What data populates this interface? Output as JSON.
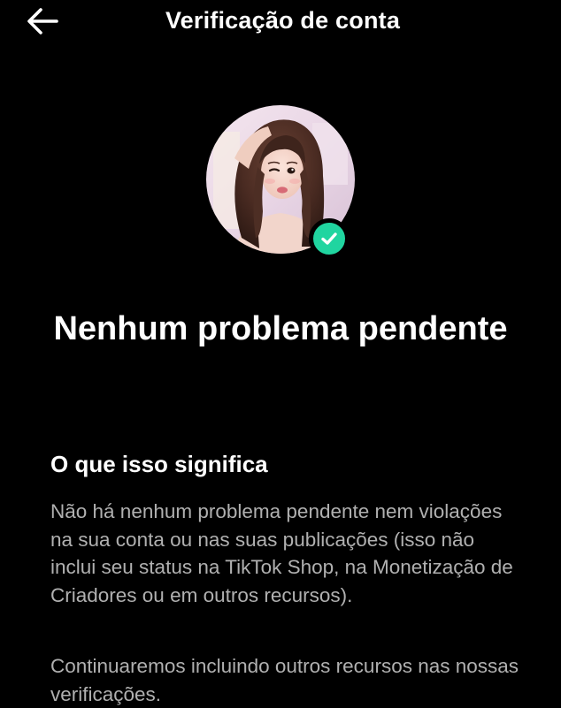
{
  "header": {
    "back_icon": "arrow-left-icon",
    "title": "Verificação de conta"
  },
  "profile": {
    "badge_icon": "check-icon",
    "badge_color": "#20d5a0"
  },
  "status": {
    "title": "Nenhum problema pendente"
  },
  "details": {
    "heading": "O que isso significa",
    "paragraph_1": "Não há nenhum problema pendente nem violações na sua conta ou nas suas publicações (isso não inclui seu status na TikTok Shop, na Monetização de Criadores ou em outros recursos).",
    "paragraph_2": "Continuaremos incluindo outros recursos nas nossas verificações."
  },
  "colors": {
    "background": "#000000",
    "text_primary": "#ffffff",
    "text_secondary": "#b0b0b0",
    "accent": "#20d5a0"
  }
}
